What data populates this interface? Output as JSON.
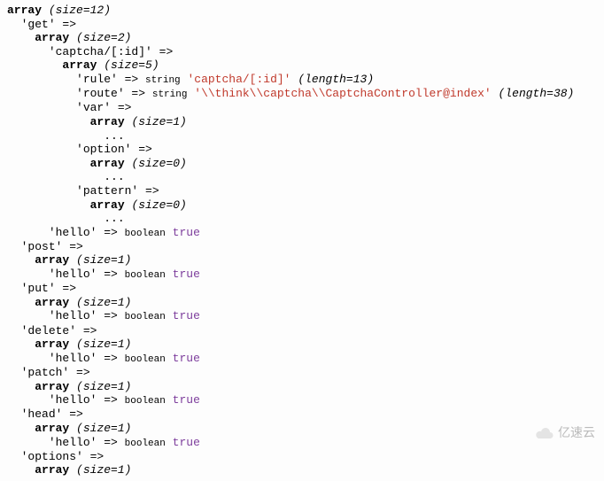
{
  "dump": {
    "root_size": "(size=12)",
    "get": {
      "key": "'get'",
      "size": "(size=2)",
      "captcha": {
        "key": "'captcha/[:id]'",
        "size": "(size=5)",
        "rule": {
          "k": "'rule'",
          "t": "string",
          "v": "'captcha/[:id]'",
          "len": "(length=13)"
        },
        "route": {
          "k": "'route'",
          "t": "string",
          "v": "'\\\\think\\\\captcha\\\\CaptchaController@index'",
          "len": "(length=38)"
        },
        "var": {
          "k": "'var'",
          "size": "(size=1)"
        },
        "option": {
          "k": "'option'",
          "size": "(size=0)"
        },
        "pattern": {
          "k": "'pattern'",
          "size": "(size=0)"
        }
      },
      "hello": {
        "k": "'hello'",
        "t": "boolean",
        "v": "true"
      }
    },
    "methods": [
      {
        "name": "'post'",
        "size": "(size=1)",
        "hello_k": "'hello'",
        "hello_t": "boolean",
        "hello_v": "true"
      },
      {
        "name": "'put'",
        "size": "(size=1)",
        "hello_k": "'hello'",
        "hello_t": "boolean",
        "hello_v": "true"
      },
      {
        "name": "'delete'",
        "size": "(size=1)",
        "hello_k": "'hello'",
        "hello_t": "boolean",
        "hello_v": "true"
      },
      {
        "name": "'patch'",
        "size": "(size=1)",
        "hello_k": "'hello'",
        "hello_t": "boolean",
        "hello_v": "true"
      },
      {
        "name": "'head'",
        "size": "(size=1)",
        "hello_k": "'hello'",
        "hello_t": "boolean",
        "hello_v": "true"
      }
    ],
    "options": {
      "name": "'options'",
      "size": "(size=1)"
    }
  },
  "watermark": "亿速云",
  "tokens": {
    "array": "array",
    "arrow": " => ",
    "dots": "..."
  }
}
